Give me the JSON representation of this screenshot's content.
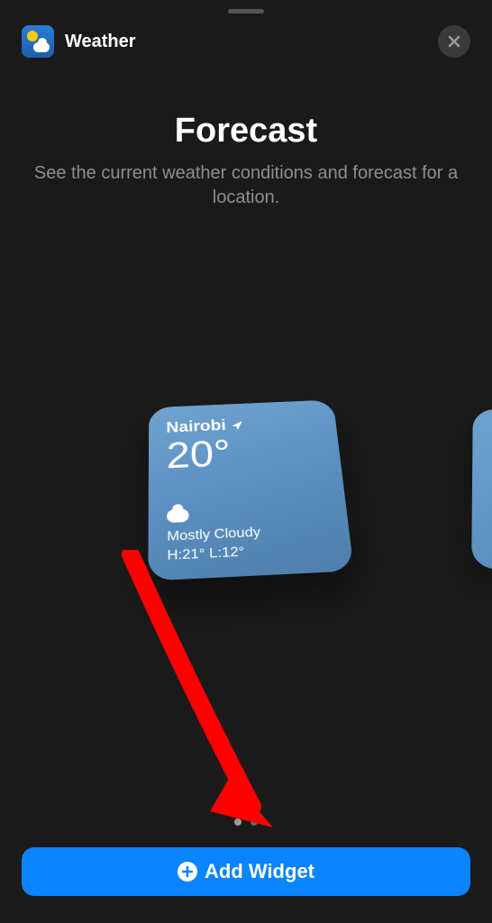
{
  "header": {
    "app_name": "Weather"
  },
  "page": {
    "title": "Forecast",
    "subtitle": "See the current weather conditions and forecast for a location."
  },
  "widget": {
    "location": "Nairobi",
    "temperature": "20°",
    "condition": "Mostly Cloudy",
    "range": "H:21° L:12°"
  },
  "pagination": {
    "current": 1,
    "total": 2
  },
  "actions": {
    "add_widget_label": "Add Widget"
  }
}
